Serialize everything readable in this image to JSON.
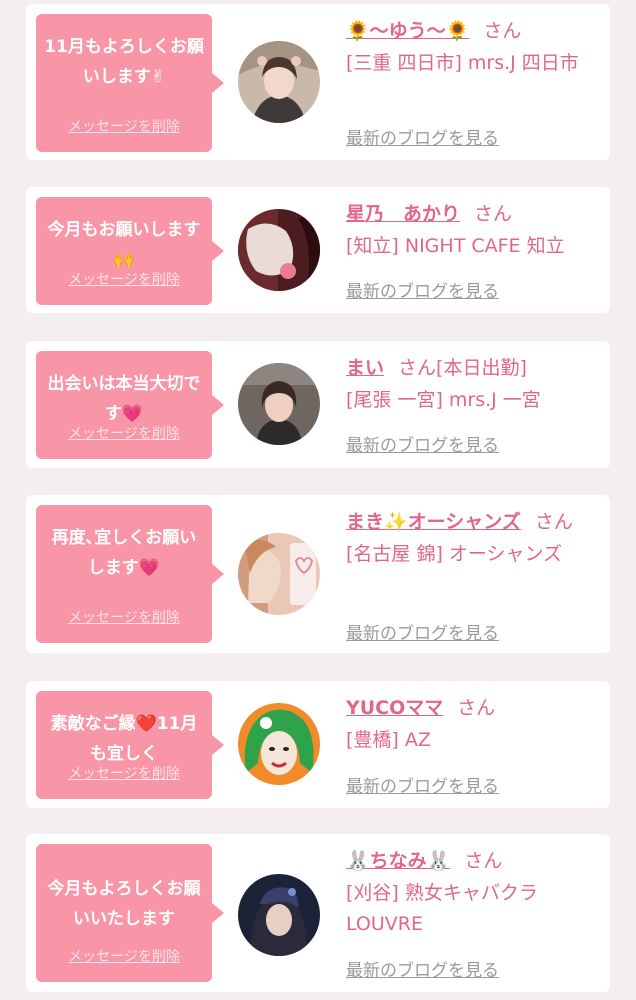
{
  "theme": {
    "accent": "#f895a6",
    "link": "#e26687",
    "muted": "#9a9a9a"
  },
  "cards": [
    {
      "message": "11月もよろしくお願いします✌",
      "name": "🌻〜ゆう〜🌻",
      "san": "さん",
      "status": "",
      "shop": "[三重 四日市] mrs.J 四日市",
      "delete_label": "メッセージを削除",
      "blog_label": "最新のブログを見る"
    },
    {
      "message": "今月もお願いします🙌",
      "name": "星乃　あかり",
      "san": "さん",
      "status": "",
      "shop": "[知立] NIGHT CAFE 知立",
      "delete_label": "メッセージを削除",
      "blog_label": "最新のブログを見る"
    },
    {
      "message": "出会いは本当大切です💗",
      "name": "まい",
      "san": "さん",
      "status": "[本日出勤]",
      "shop": "[尾張 一宮] mrs.J 一宮",
      "delete_label": "メッセージを削除",
      "blog_label": "最新のブログを見る"
    },
    {
      "message": "再度､宜しくお願いします💗",
      "name": "まき✨オーシャンズ",
      "san": "さん",
      "status": "",
      "shop": "[名古屋 錦] オーシャンズ",
      "delete_label": "メッセージを削除",
      "blog_label": "最新のブログを見る"
    },
    {
      "message": "素敵なご縁❤️11月も宜しく",
      "name": "YUCOママ",
      "san": "さん",
      "status": "",
      "shop": "[豊橋] AZ",
      "delete_label": "メッセージを削除",
      "blog_label": "最新のブログを見る"
    },
    {
      "message": "今月もよろしくお願いいたします",
      "name": "🐰ちなみ🐰",
      "san": "さん",
      "status": "",
      "shop": "[刈谷] 熟女キャバクラ LOUVRE",
      "delete_label": "メッセージを削除",
      "blog_label": "最新のブログを見る"
    }
  ]
}
